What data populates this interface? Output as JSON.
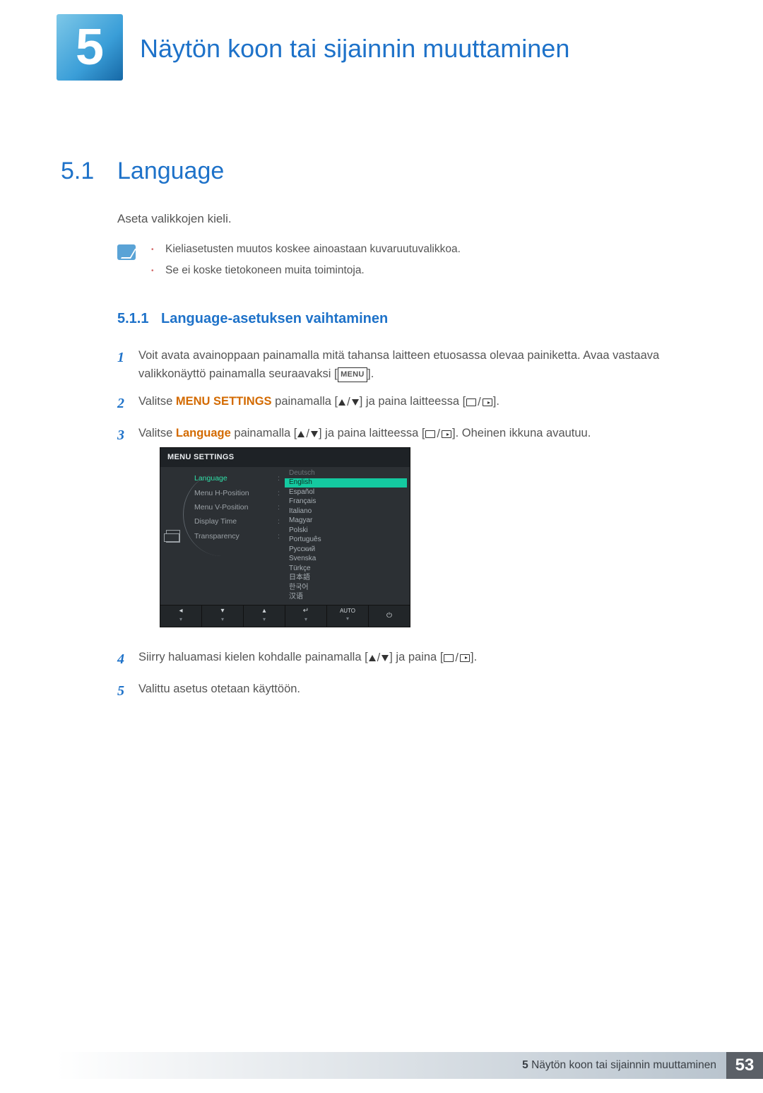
{
  "header": {
    "chapter_number": "5",
    "chapter_title": "Näytön koon tai sijainnin muuttaminen"
  },
  "section": {
    "number": "5.1",
    "title": "Language",
    "intro": "Aseta valikkojen kieli."
  },
  "notes": [
    "Kieliasetusten muutos koskee ainoastaan kuvaruutuvalikkoa.",
    "Se ei koske tietokoneen muita toimintoja."
  ],
  "subsection": {
    "number": "5.1.1",
    "title": "Language-asetuksen vaihtaminen"
  },
  "steps": {
    "s1a": "Voit avata avainoppaan painamalla mitä tahansa laitteen etuosassa olevaa painiketta. Avaa vastaava valikkonäyttö painamalla seuraavaksi [",
    "s1b": "].",
    "menu_label": "MENU",
    "s2a": "Valitse ",
    "s2_kw": "MENU SETTINGS",
    "s2b": " painamalla [",
    "s2c": "] ja paina laitteessa [",
    "s2d": "].",
    "s3a": "Valitse ",
    "s3_kw": "Language",
    "s3b": " painamalla [",
    "s3c": "] ja paina laitteessa [",
    "s3d": "]. Oheinen ikkuna avautuu.",
    "s4a": "Siirry haluamasi kielen kohdalle painamalla [",
    "s4b": "] ja paina [",
    "s4c": "].",
    "s5": "Valittu asetus otetaan käyttöön."
  },
  "step_numbers": [
    "1",
    "2",
    "3",
    "4",
    "5"
  ],
  "osd": {
    "title": "MENU SETTINGS",
    "menu_items": [
      "Language",
      "Menu H-Position",
      "Menu V-Position",
      "Display Time",
      "Transparency"
    ],
    "languages": [
      "Deutsch",
      "English",
      "Español",
      "Français",
      "Italiano",
      "Magyar",
      "Polski",
      "Português",
      "Русский",
      "Svenska",
      "Türkçe",
      "日本語",
      "한국어",
      "汉语"
    ],
    "highlight_index": 1,
    "bottom": {
      "auto": "AUTO"
    }
  },
  "footer": {
    "chapter_ref_num": "5",
    "chapter_ref_title": "Näytön koon tai sijainnin muuttaminen",
    "page": "53"
  }
}
